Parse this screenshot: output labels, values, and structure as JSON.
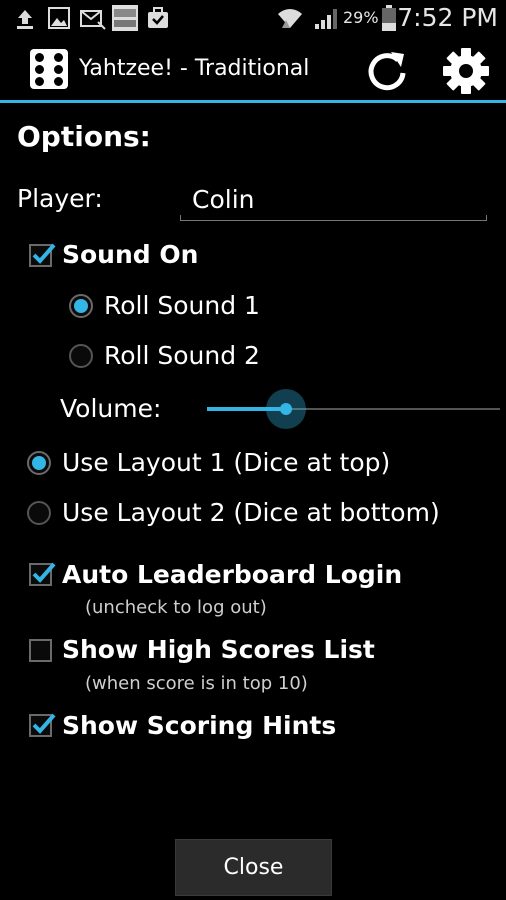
{
  "status_bar": {
    "battery_percent": "29%",
    "time": "7:52 PM",
    "notification_icons": [
      "upload-icon",
      "image-icon",
      "email-icon",
      "basic4android-icon",
      "briefcase-icon"
    ],
    "system_icons": [
      "wifi-icon",
      "signal-icon",
      "battery-icon"
    ]
  },
  "action_bar": {
    "title": "Yahtzee! - Traditional",
    "refresh_icon": "refresh-icon",
    "settings_icon": "gear-icon",
    "accent_color": "#33b5e5"
  },
  "options": {
    "heading": "Options:",
    "player_label": "Player:",
    "player_value": "Colin",
    "sound_on": {
      "label": "Sound On",
      "checked": true
    },
    "roll_sounds": [
      {
        "label": "Roll Sound 1",
        "selected": true
      },
      {
        "label": "Roll Sound 2",
        "selected": false
      }
    ],
    "volume_label": "Volume:",
    "volume_level": 0.27,
    "layouts": [
      {
        "label": "Use Layout 1 (Dice at top)",
        "selected": true
      },
      {
        "label": "Use Layout 2 (Dice at bottom)",
        "selected": false
      }
    ],
    "auto_leaderboard": {
      "label": "Auto Leaderboard Login",
      "hint": "(uncheck to log out)",
      "checked": true
    },
    "high_scores": {
      "label": "Show High Scores List",
      "hint": "(when score is in top 10)",
      "checked": false
    },
    "scoring_hints": {
      "label": "Show Scoring Hints",
      "checked": true
    }
  },
  "close_button": "Close"
}
